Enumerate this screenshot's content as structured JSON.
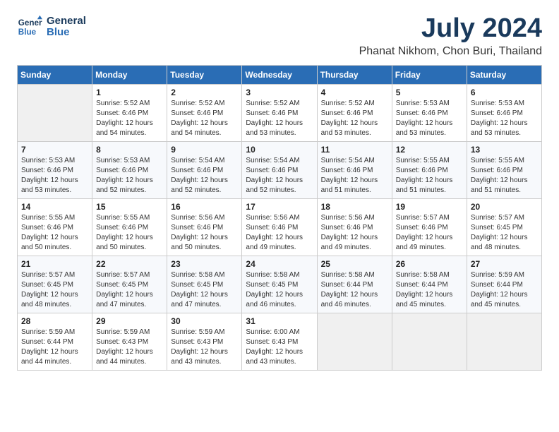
{
  "header": {
    "logo_line1": "General",
    "logo_line2": "Blue",
    "month_title": "July 2024",
    "location": "Phanat Nikhom, Chon Buri, Thailand"
  },
  "calendar": {
    "days_of_week": [
      "Sunday",
      "Monday",
      "Tuesday",
      "Wednesday",
      "Thursday",
      "Friday",
      "Saturday"
    ],
    "weeks": [
      [
        {
          "day": "",
          "info": ""
        },
        {
          "day": "1",
          "info": "Sunrise: 5:52 AM\nSunset: 6:46 PM\nDaylight: 12 hours\nand 54 minutes."
        },
        {
          "day": "2",
          "info": "Sunrise: 5:52 AM\nSunset: 6:46 PM\nDaylight: 12 hours\nand 54 minutes."
        },
        {
          "day": "3",
          "info": "Sunrise: 5:52 AM\nSunset: 6:46 PM\nDaylight: 12 hours\nand 53 minutes."
        },
        {
          "day": "4",
          "info": "Sunrise: 5:52 AM\nSunset: 6:46 PM\nDaylight: 12 hours\nand 53 minutes."
        },
        {
          "day": "5",
          "info": "Sunrise: 5:53 AM\nSunset: 6:46 PM\nDaylight: 12 hours\nand 53 minutes."
        },
        {
          "day": "6",
          "info": "Sunrise: 5:53 AM\nSunset: 6:46 PM\nDaylight: 12 hours\nand 53 minutes."
        }
      ],
      [
        {
          "day": "7",
          "info": "Sunrise: 5:53 AM\nSunset: 6:46 PM\nDaylight: 12 hours\nand 53 minutes."
        },
        {
          "day": "8",
          "info": "Sunrise: 5:53 AM\nSunset: 6:46 PM\nDaylight: 12 hours\nand 52 minutes."
        },
        {
          "day": "9",
          "info": "Sunrise: 5:54 AM\nSunset: 6:46 PM\nDaylight: 12 hours\nand 52 minutes."
        },
        {
          "day": "10",
          "info": "Sunrise: 5:54 AM\nSunset: 6:46 PM\nDaylight: 12 hours\nand 52 minutes."
        },
        {
          "day": "11",
          "info": "Sunrise: 5:54 AM\nSunset: 6:46 PM\nDaylight: 12 hours\nand 51 minutes."
        },
        {
          "day": "12",
          "info": "Sunrise: 5:55 AM\nSunset: 6:46 PM\nDaylight: 12 hours\nand 51 minutes."
        },
        {
          "day": "13",
          "info": "Sunrise: 5:55 AM\nSunset: 6:46 PM\nDaylight: 12 hours\nand 51 minutes."
        }
      ],
      [
        {
          "day": "14",
          "info": "Sunrise: 5:55 AM\nSunset: 6:46 PM\nDaylight: 12 hours\nand 50 minutes."
        },
        {
          "day": "15",
          "info": "Sunrise: 5:55 AM\nSunset: 6:46 PM\nDaylight: 12 hours\nand 50 minutes."
        },
        {
          "day": "16",
          "info": "Sunrise: 5:56 AM\nSunset: 6:46 PM\nDaylight: 12 hours\nand 50 minutes."
        },
        {
          "day": "17",
          "info": "Sunrise: 5:56 AM\nSunset: 6:46 PM\nDaylight: 12 hours\nand 49 minutes."
        },
        {
          "day": "18",
          "info": "Sunrise: 5:56 AM\nSunset: 6:46 PM\nDaylight: 12 hours\nand 49 minutes."
        },
        {
          "day": "19",
          "info": "Sunrise: 5:57 AM\nSunset: 6:46 PM\nDaylight: 12 hours\nand 49 minutes."
        },
        {
          "day": "20",
          "info": "Sunrise: 5:57 AM\nSunset: 6:45 PM\nDaylight: 12 hours\nand 48 minutes."
        }
      ],
      [
        {
          "day": "21",
          "info": "Sunrise: 5:57 AM\nSunset: 6:45 PM\nDaylight: 12 hours\nand 48 minutes."
        },
        {
          "day": "22",
          "info": "Sunrise: 5:57 AM\nSunset: 6:45 PM\nDaylight: 12 hours\nand 47 minutes."
        },
        {
          "day": "23",
          "info": "Sunrise: 5:58 AM\nSunset: 6:45 PM\nDaylight: 12 hours\nand 47 minutes."
        },
        {
          "day": "24",
          "info": "Sunrise: 5:58 AM\nSunset: 6:45 PM\nDaylight: 12 hours\nand 46 minutes."
        },
        {
          "day": "25",
          "info": "Sunrise: 5:58 AM\nSunset: 6:44 PM\nDaylight: 12 hours\nand 46 minutes."
        },
        {
          "day": "26",
          "info": "Sunrise: 5:58 AM\nSunset: 6:44 PM\nDaylight: 12 hours\nand 45 minutes."
        },
        {
          "day": "27",
          "info": "Sunrise: 5:59 AM\nSunset: 6:44 PM\nDaylight: 12 hours\nand 45 minutes."
        }
      ],
      [
        {
          "day": "28",
          "info": "Sunrise: 5:59 AM\nSunset: 6:44 PM\nDaylight: 12 hours\nand 44 minutes."
        },
        {
          "day": "29",
          "info": "Sunrise: 5:59 AM\nSunset: 6:43 PM\nDaylight: 12 hours\nand 44 minutes."
        },
        {
          "day": "30",
          "info": "Sunrise: 5:59 AM\nSunset: 6:43 PM\nDaylight: 12 hours\nand 43 minutes."
        },
        {
          "day": "31",
          "info": "Sunrise: 6:00 AM\nSunset: 6:43 PM\nDaylight: 12 hours\nand 43 minutes."
        },
        {
          "day": "",
          "info": ""
        },
        {
          "day": "",
          "info": ""
        },
        {
          "day": "",
          "info": ""
        }
      ]
    ]
  }
}
